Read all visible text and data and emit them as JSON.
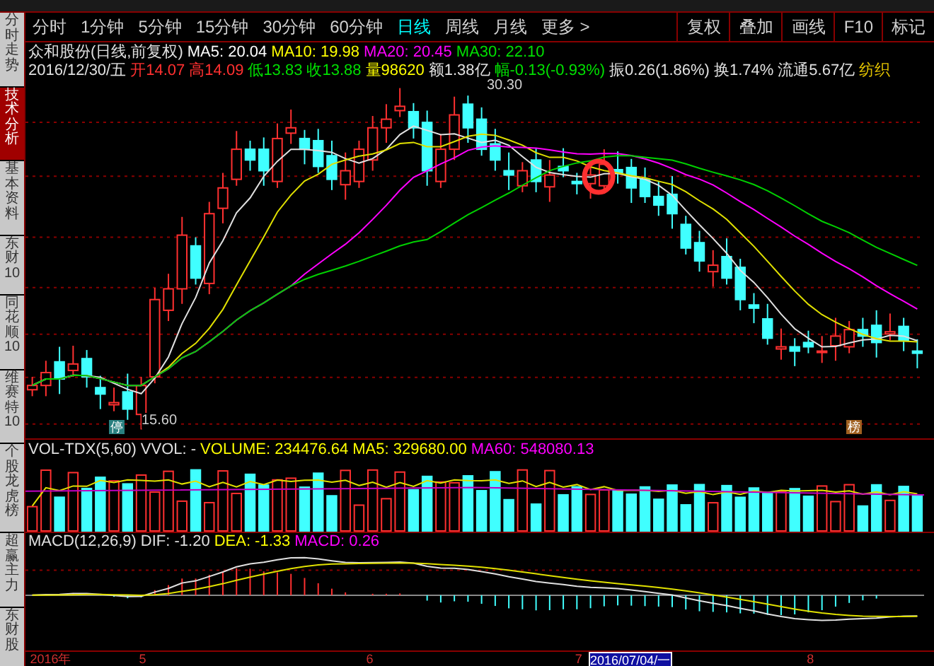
{
  "toolbar": {
    "periods": [
      {
        "label": "分时",
        "selected": false
      },
      {
        "label": "1分钟",
        "selected": false
      },
      {
        "label": "5分钟",
        "selected": false
      },
      {
        "label": "15分钟",
        "selected": false
      },
      {
        "label": "30分钟",
        "selected": false
      },
      {
        "label": "60分钟",
        "selected": false
      },
      {
        "label": "日线",
        "selected": true
      },
      {
        "label": "周线",
        "selected": false
      },
      {
        "label": "月线",
        "selected": false
      },
      {
        "label": "更多 >",
        "selected": false
      }
    ],
    "actions": [
      "复权",
      "叠加",
      "画线",
      "F10",
      "标记"
    ]
  },
  "sidebar": {
    "tabs": [
      {
        "label": "分时走势",
        "selected": false
      },
      {
        "label": "技术分析",
        "selected": true
      },
      {
        "label": "基本资料",
        "selected": false
      },
      {
        "label": "东财10",
        "selected": false
      },
      {
        "label": "同花顺10",
        "selected": false
      },
      {
        "label": "维赛特10",
        "selected": false
      },
      {
        "label": "个股龙虎榜",
        "selected": false
      },
      {
        "label": "超赢主力",
        "selected": false
      },
      {
        "label": "东财股",
        "selected": false
      }
    ]
  },
  "quote": {
    "title": "众和股份(日线,前复权)",
    "moving_averages": [
      {
        "label": "MA5: 20.04",
        "color": "#ffffff"
      },
      {
        "label": "MA10: 19.98",
        "color": "#ffff00"
      },
      {
        "label": "MA20: 20.45",
        "color": "#ff00ff"
      },
      {
        "label": "MA30: 22.10",
        "color": "#00e000"
      }
    ],
    "fields": [
      {
        "label": "2016/12/30/五",
        "color": "#e0e0e0"
      },
      {
        "label": "开14.07",
        "color": "#ff3030"
      },
      {
        "label": "高14.09",
        "color": "#ff3030"
      },
      {
        "label": "低13.83",
        "color": "#00e000"
      },
      {
        "label": "收13.88",
        "color": "#00e000"
      },
      {
        "label": "量98620",
        "color": "#ffff00"
      },
      {
        "label": "额1.38亿",
        "color": "#e0e0e0"
      },
      {
        "label": "幅-0.13(-0.93%)",
        "color": "#00e000"
      },
      {
        "label": "振0.26(1.86%)",
        "color": "#e0e0e0"
      },
      {
        "label": "换1.74%",
        "color": "#e0e0e0"
      },
      {
        "label": "流通5.67亿",
        "color": "#e0e0e0"
      },
      {
        "label": "纺织",
        "color": "#e0c000"
      }
    ]
  },
  "price_chart": {
    "high_label": "30.30",
    "low_label": "15.60",
    "badges": [
      {
        "label": "停",
        "kind": "halt"
      },
      {
        "label": "榜",
        "kind": "list"
      }
    ]
  },
  "volume_panel": {
    "items": [
      {
        "label": "VOL-TDX(5,60)",
        "color": "#e0e0e0"
      },
      {
        "label": "VVOL: -",
        "color": "#e0e0e0"
      },
      {
        "label": "VOLUME: 234476.64",
        "color": "#ffff00"
      },
      {
        "label": "MA5: 329680.00",
        "color": "#ffff00"
      },
      {
        "label": "MA60: 548080.13",
        "color": "#ff00ff"
      }
    ]
  },
  "macd_panel": {
    "items": [
      {
        "label": "MACD(12,26,9)",
        "color": "#e0e0e0"
      },
      {
        "label": "DIF: -1.20",
        "color": "#e0e0e0"
      },
      {
        "label": "DEA: -1.33",
        "color": "#ffff00"
      },
      {
        "label": "MACD: 0.26",
        "color": "#ff00ff"
      }
    ]
  },
  "time_axis": [
    {
      "label": "2016年",
      "kind": "tick"
    },
    {
      "label": "5",
      "kind": "tick"
    },
    {
      "label": "6",
      "kind": "tick"
    },
    {
      "label": "7",
      "kind": "tick"
    },
    {
      "label": "2016/07/04/一",
      "kind": "cursor"
    },
    {
      "label": "8",
      "kind": "tick"
    }
  ]
}
